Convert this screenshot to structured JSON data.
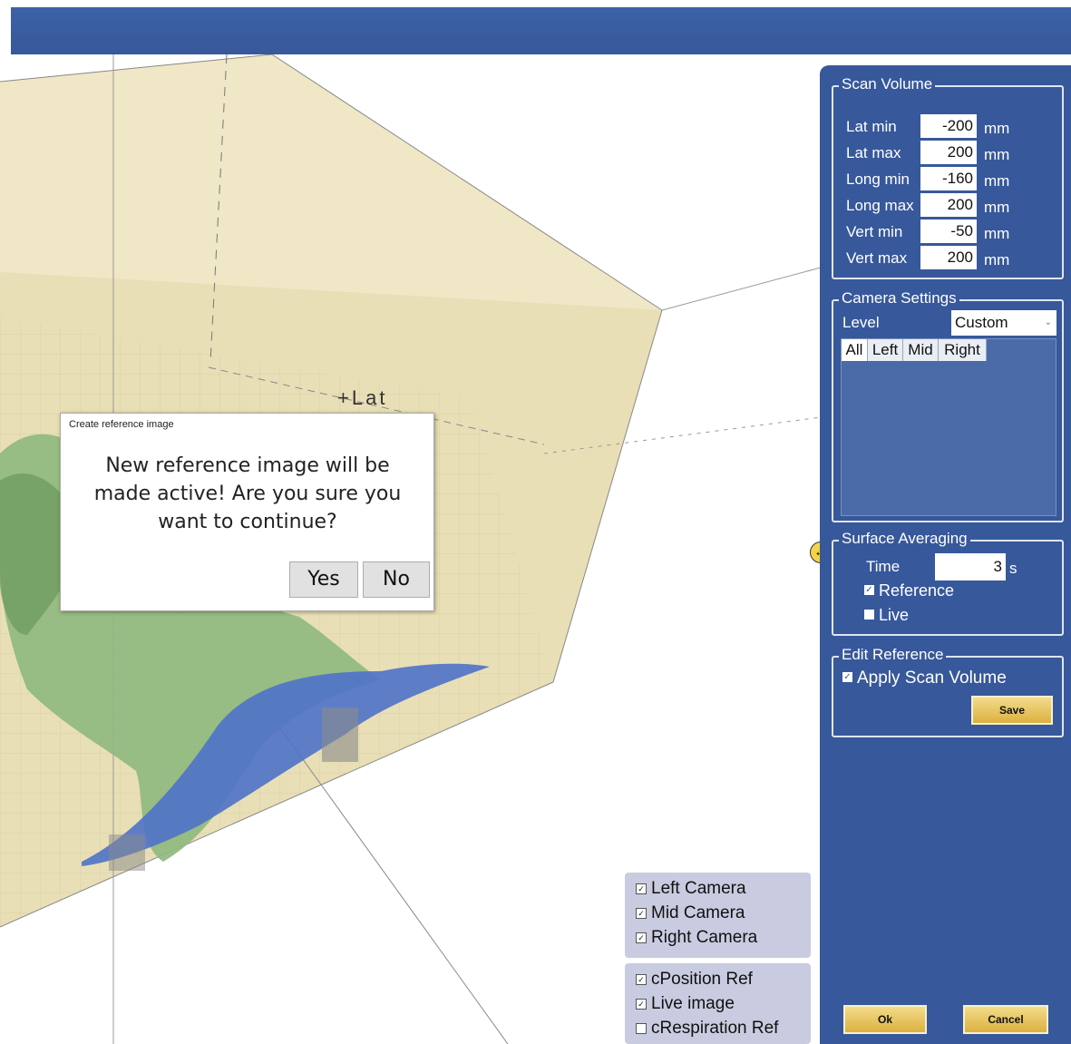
{
  "viewport": {
    "axis_label": "+Lat"
  },
  "dialog": {
    "title": "Create reference image",
    "message": "New reference image will be made active! Are you sure you want to continue?",
    "yes_label": "Yes",
    "no_label": "No"
  },
  "camera_toggles": [
    {
      "label": "Left Camera",
      "checked": true
    },
    {
      "label": "Mid Camera",
      "checked": true
    },
    {
      "label": "Right Camera",
      "checked": true
    }
  ],
  "ref_toggles": [
    {
      "label": "cPosition Ref",
      "checked": true
    },
    {
      "label": "Live image",
      "checked": true
    },
    {
      "label": "cRespiration Ref",
      "checked": false
    }
  ],
  "scan_volume": {
    "title": "Scan Volume",
    "rows": [
      {
        "label": "Lat min",
        "value": "-200",
        "unit": "mm"
      },
      {
        "label": "Lat max",
        "value": "200",
        "unit": "mm"
      },
      {
        "label": "Long min",
        "value": "-160",
        "unit": "mm"
      },
      {
        "label": "Long max",
        "value": "200",
        "unit": "mm"
      },
      {
        "label": "Vert min",
        "value": "-50",
        "unit": "mm"
      },
      {
        "label": "Vert max",
        "value": "200",
        "unit": "mm"
      }
    ]
  },
  "camera_settings": {
    "title": "Camera Settings",
    "level_label": "Level",
    "level_value": "Custom",
    "tabs": [
      "All",
      "Left",
      "Mid",
      "Right"
    ]
  },
  "surface_averaging": {
    "title": "Surface Averaging",
    "time_label": "Time",
    "time_value": "3",
    "time_unit": "s",
    "reference_label": "Reference",
    "reference_checked": true,
    "live_label": "Live",
    "live_checked": false
  },
  "edit_reference": {
    "title": "Edit Reference",
    "apply_label": "Apply Scan Volume",
    "apply_checked": true,
    "save_label": "Save"
  },
  "footer": {
    "ok_label": "Ok",
    "cancel_label": "Cancel"
  },
  "colors": {
    "panel_blue": "#37589a",
    "button_yellow": "#e7c45a",
    "box_face": "#ede5c2",
    "surface_green": "#8fb980",
    "surface_blue": "#4f72c9"
  }
}
